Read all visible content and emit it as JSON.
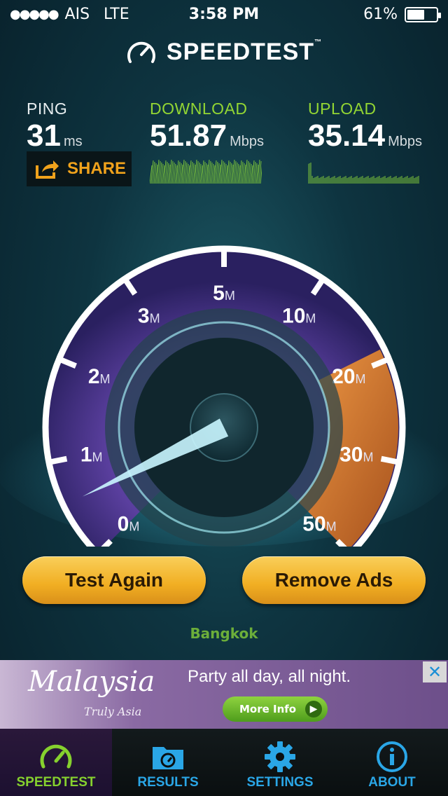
{
  "status_bar": {
    "signal_dots": "●●●●●",
    "carrier": "AIS",
    "network": "LTE",
    "time": "3:58 PM",
    "battery_text": "61%",
    "battery_level": 0.61
  },
  "brand": {
    "name": "SPEEDTEST",
    "tm": "™"
  },
  "metrics": {
    "ping": {
      "label": "PING",
      "value": "31",
      "unit": "ms"
    },
    "download": {
      "label": "DOWNLOAD",
      "value": "51.87",
      "unit": "Mbps"
    },
    "upload": {
      "label": "UPLOAD",
      "value": "35.14",
      "unit": "Mbps"
    }
  },
  "share": {
    "label": "SHARE",
    "icon": "share-icon"
  },
  "gauge": {
    "ticks": [
      {
        "num": "0",
        "suffix": "M"
      },
      {
        "num": "1",
        "suffix": "M"
      },
      {
        "num": "2",
        "suffix": "M"
      },
      {
        "num": "3",
        "suffix": "M"
      },
      {
        "num": "5",
        "suffix": "M"
      },
      {
        "num": "10",
        "suffix": "M"
      },
      {
        "num": "20",
        "suffix": "M"
      },
      {
        "num": "30",
        "suffix": "M"
      },
      {
        "num": "50",
        "suffix": "M"
      }
    ],
    "colors": {
      "arc": "#ffffff",
      "purple": "#6a4bb0",
      "orange": "#e07a2a",
      "needle": "#bff4ff"
    }
  },
  "buttons": {
    "test_again": "Test Again",
    "remove_ads": "Remove Ads"
  },
  "server": "Bangkok",
  "ad": {
    "brand": "Malaysia",
    "tagline": "Truly Asia",
    "headline": "Party all day, all night.",
    "cta": "More Info",
    "close": "✕"
  },
  "tabs": [
    {
      "label": "SPEEDTEST",
      "icon": "speedometer-icon",
      "active": true
    },
    {
      "label": "RESULTS",
      "icon": "folder-icon",
      "active": false
    },
    {
      "label": "SETTINGS",
      "icon": "gear-icon",
      "active": false
    },
    {
      "label": "ABOUT",
      "icon": "info-icon",
      "active": false
    }
  ]
}
